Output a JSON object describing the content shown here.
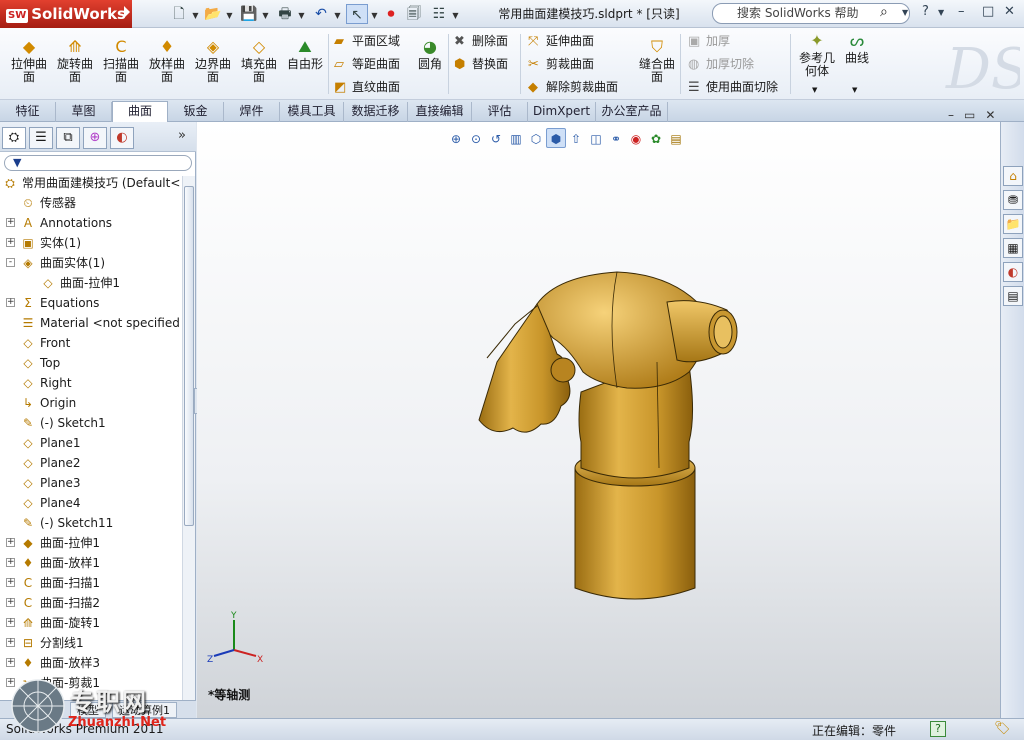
{
  "app": {
    "logo_text": "SolidWorks",
    "logo_badge": "SW"
  },
  "titlebar": {
    "document": "常用曲面建模技巧.sldprt * [只读]",
    "search_placeholder": "搜索 SolidWorks 帮助",
    "help_label": "?",
    "win_buttons": [
      "–",
      "□",
      "✕"
    ]
  },
  "ribbon": {
    "big_buttons": [
      {
        "label": "拉伸曲\n面",
        "icon": "extrude-surface-icon"
      },
      {
        "label": "旋转曲\n面",
        "icon": "revolve-surface-icon"
      },
      {
        "label": "扫描曲\n面",
        "icon": "sweep-surface-icon"
      },
      {
        "label": "放样曲\n面",
        "icon": "loft-surface-icon"
      },
      {
        "label": "边界曲\n面",
        "icon": "boundary-surface-icon"
      },
      {
        "label": "填充曲\n面",
        "icon": "fill-surface-icon"
      },
      {
        "label": "自由形",
        "icon": "freeform-icon"
      }
    ],
    "col1": [
      "平面区域",
      "等距曲面",
      "直纹曲面"
    ],
    "fillet": "圆角",
    "col2": [
      "删除面",
      "替换面"
    ],
    "col3": [
      "延伸曲面",
      "剪裁曲面",
      "解除剪裁曲面"
    ],
    "knit": "缝合曲\n面",
    "col4": [
      "加厚",
      "加厚切除",
      "使用曲面切除"
    ],
    "refgeo": "参考几\n何体",
    "curves": "曲线"
  },
  "tabs": [
    "特征",
    "草图",
    "曲面",
    "钣金",
    "焊件",
    "模具工具",
    "数据迁移",
    "直接编辑",
    "评估",
    "DimXpert",
    "办公室产品"
  ],
  "active_tab": "曲面",
  "tree": {
    "items": [
      {
        "label": "常用曲面建模技巧  (Default<",
        "level": 0,
        "exp": "",
        "icon": "part-icon"
      },
      {
        "label": "传感器",
        "level": 1,
        "exp": "",
        "icon": "sensor-icon"
      },
      {
        "label": "Annotations",
        "level": 1,
        "exp": "+",
        "icon": "annotations-icon"
      },
      {
        "label": "实体(1)",
        "level": 1,
        "exp": "+",
        "icon": "solid-bodies-icon"
      },
      {
        "label": "曲面实体(1)",
        "level": 1,
        "exp": "-",
        "icon": "surface-bodies-icon"
      },
      {
        "label": "曲面-拉伸1",
        "level": 2,
        "exp": "",
        "icon": "surface-icon"
      },
      {
        "label": "Equations",
        "level": 1,
        "exp": "+",
        "icon": "equations-icon"
      },
      {
        "label": "Material <not specified",
        "level": 1,
        "exp": "",
        "icon": "material-icon"
      },
      {
        "label": "Front",
        "level": 1,
        "exp": "",
        "icon": "plane-icon"
      },
      {
        "label": "Top",
        "level": 1,
        "exp": "",
        "icon": "plane-icon"
      },
      {
        "label": "Right",
        "level": 1,
        "exp": "",
        "icon": "plane-icon"
      },
      {
        "label": "Origin",
        "level": 1,
        "exp": "",
        "icon": "origin-icon"
      },
      {
        "label": "(-) Sketch1",
        "level": 1,
        "exp": "",
        "icon": "sketch-icon"
      },
      {
        "label": "Plane1",
        "level": 1,
        "exp": "",
        "icon": "plane-icon"
      },
      {
        "label": "Plane2",
        "level": 1,
        "exp": "",
        "icon": "plane-icon"
      },
      {
        "label": "Plane3",
        "level": 1,
        "exp": "",
        "icon": "plane-icon"
      },
      {
        "label": "Plane4",
        "level": 1,
        "exp": "",
        "icon": "plane-icon"
      },
      {
        "label": "(-) Sketch11",
        "level": 1,
        "exp": "",
        "icon": "sketch-icon"
      },
      {
        "label": "曲面-拉伸1",
        "level": 1,
        "exp": "+",
        "icon": "extrude-surface-icon"
      },
      {
        "label": "曲面-放样1",
        "level": 1,
        "exp": "+",
        "icon": "loft-surface-icon"
      },
      {
        "label": "曲面-扫描1",
        "level": 1,
        "exp": "+",
        "icon": "sweep-surface-icon"
      },
      {
        "label": "曲面-扫描2",
        "level": 1,
        "exp": "+",
        "icon": "sweep-surface-icon"
      },
      {
        "label": "曲面-旋转1",
        "level": 1,
        "exp": "+",
        "icon": "revolve-surface-icon"
      },
      {
        "label": "分割线1",
        "level": 1,
        "exp": "+",
        "icon": "split-line-icon"
      },
      {
        "label": "曲面-放样3",
        "level": 1,
        "exp": "+",
        "icon": "loft-surface-icon"
      },
      {
        "label": "曲面-剪裁1",
        "level": 1,
        "exp": "+",
        "icon": "trim-surface-icon"
      }
    ]
  },
  "panel_bottom_tabs": [
    "模型",
    "运动算例1"
  ],
  "viewport": {
    "view_name": "*等轴测",
    "triad": {
      "x": "X",
      "y": "Y",
      "z": "Z"
    }
  },
  "status": {
    "left": "SolidWorks Premium 2011",
    "edit": "正在编辑：零件",
    "help": "?"
  },
  "watermark": {
    "text": "专职网",
    "url": "Zhuanzhi.Net"
  },
  "colors": {
    "model": "#c8952a",
    "accent": "#c22a1c"
  }
}
